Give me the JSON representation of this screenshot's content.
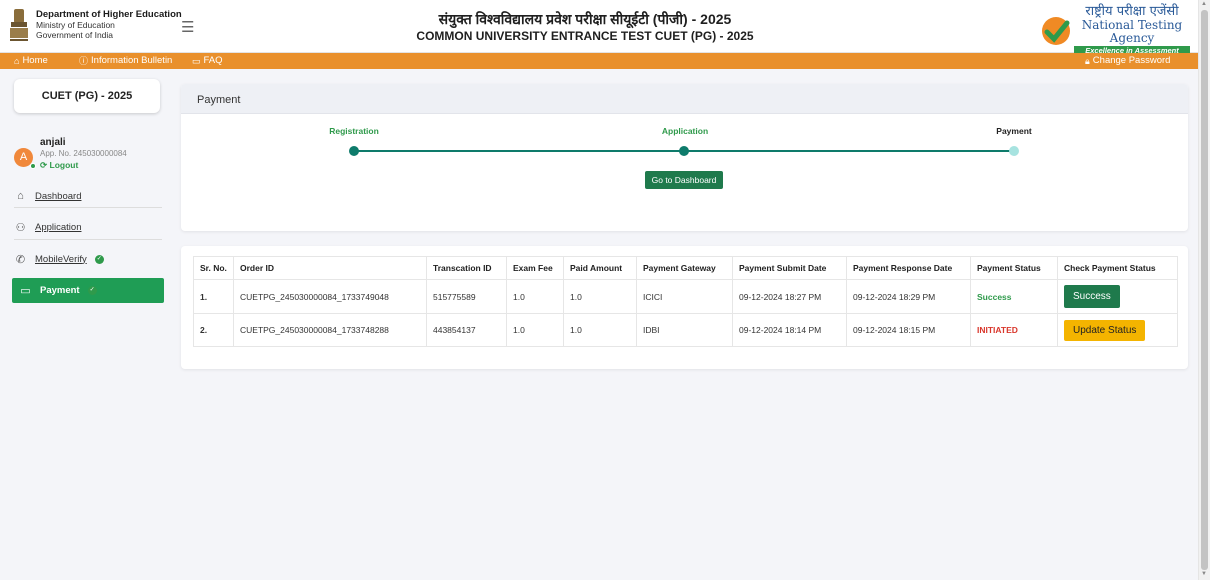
{
  "header": {
    "department": "Department of Higher Education",
    "ministry": "Ministry of Education",
    "government": "Government of India",
    "title_hindi": "संयुक्त विश्वविद्यालय प्रवेश परीक्षा सीयूईटी (पीजी) - 2025",
    "title_english": "COMMON UNIVERSITY ENTRANCE TEST CUET (PG) - 2025",
    "nta_hindi": "राष्ट्रीय परीक्षा एजेंसी",
    "nta_english": "National Testing Agency",
    "nta_tagline": "Excellence in Assessment",
    "menu_icon": "hamburger-icon"
  },
  "nav": {
    "home": "Home",
    "info_bulletin": "Information Bulletin",
    "faq": "FAQ",
    "change_password": "Change Password",
    "bar_color": "#e9902c"
  },
  "sidebar": {
    "exam_title": "CUET (PG) - 2025",
    "user": {
      "initial": "A",
      "name": "anjali",
      "app_no": "App. No. 245030000084",
      "logout": "Logout"
    },
    "items": [
      {
        "label": "Dashboard",
        "icon": "home-icon"
      },
      {
        "label": "Application",
        "icon": "user-add-icon"
      },
      {
        "label": "MobileVerify",
        "icon": "phone-icon",
        "verified": true
      },
      {
        "label": "Payment",
        "icon": "card-icon",
        "verified": true,
        "active": true
      }
    ]
  },
  "payment": {
    "title": "Payment",
    "steps": [
      {
        "label": "Registration",
        "status": "done",
        "color": "#2f9a4b"
      },
      {
        "label": "Application",
        "status": "done",
        "color": "#2f9a4b"
      },
      {
        "label": "Payment",
        "status": "pending",
        "color": "#222222"
      }
    ],
    "dashboard_button": "Go to Dashboard"
  },
  "table": {
    "headers": [
      "Sr. No.",
      "Order ID",
      "Transcation ID",
      "Exam Fee",
      "Paid Amount",
      "Payment Gateway",
      "Payment Submit Date",
      "Payment Response Date",
      "Payment Status",
      "Check Payment Status"
    ],
    "rows": [
      {
        "sr": "1.",
        "order_id": "CUETPG_245030000084_1733749048",
        "txn_id": "515775589",
        "exam_fee": "1.0",
        "paid": "1.0",
        "gateway": "ICICI",
        "submit": "09-12-2024 18:27 PM",
        "response": "09-12-2024 18:29 PM",
        "status": "Success",
        "action": "Success"
      },
      {
        "sr": "2.",
        "order_id": "CUETPG_245030000084_1733748288",
        "txn_id": "443854137",
        "exam_fee": "1.0",
        "paid": "1.0",
        "gateway": "IDBI",
        "submit": "09-12-2024 18:14 PM",
        "response": "09-12-2024 18:15 PM",
        "status": "INITIATED",
        "action": "Update Status"
      }
    ]
  },
  "colors": {
    "accent_green": "#1f9d55",
    "status_success": "#2f9a4b",
    "status_initiated": "#d9362b",
    "update_button": "#f4b400"
  }
}
